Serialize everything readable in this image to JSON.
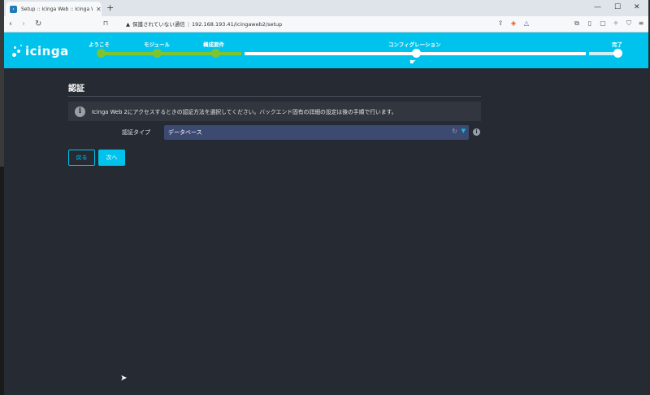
{
  "browser": {
    "tab_title": "Setup :: Icinga Web :: Icinga Web",
    "favicon": "icinga-favicon",
    "tab_close": "✕",
    "new_tab": "+",
    "security_warning": "保護されていない通信",
    "url": "192.168.193.41/icingaweb2/setup",
    "controls": {
      "minimize": "—",
      "maximize": "☐",
      "close": "✕"
    }
  },
  "header": {
    "logo_text": "icinga",
    "accent_color": "#00c3ed",
    "completed_color": "#7dc42f",
    "steps": [
      {
        "label": "ようこそ",
        "state": "done"
      },
      {
        "label": "モジュール",
        "state": "done"
      },
      {
        "label": "構成要件",
        "state": "done"
      },
      {
        "label": "コンフィグレーション",
        "state": "current"
      },
      {
        "label": "完了",
        "state": "pending"
      }
    ]
  },
  "main": {
    "section_title": "認証",
    "info_text": "Icinga Web 2にアクセスするときの認証方法を選択してください。バックエンド固有の詳細の設定は後の手順で行います。",
    "auth_type_label": "認証タイプ",
    "auth_type_value": "データベース",
    "back_button": "戻る",
    "next_button": "次へ"
  }
}
